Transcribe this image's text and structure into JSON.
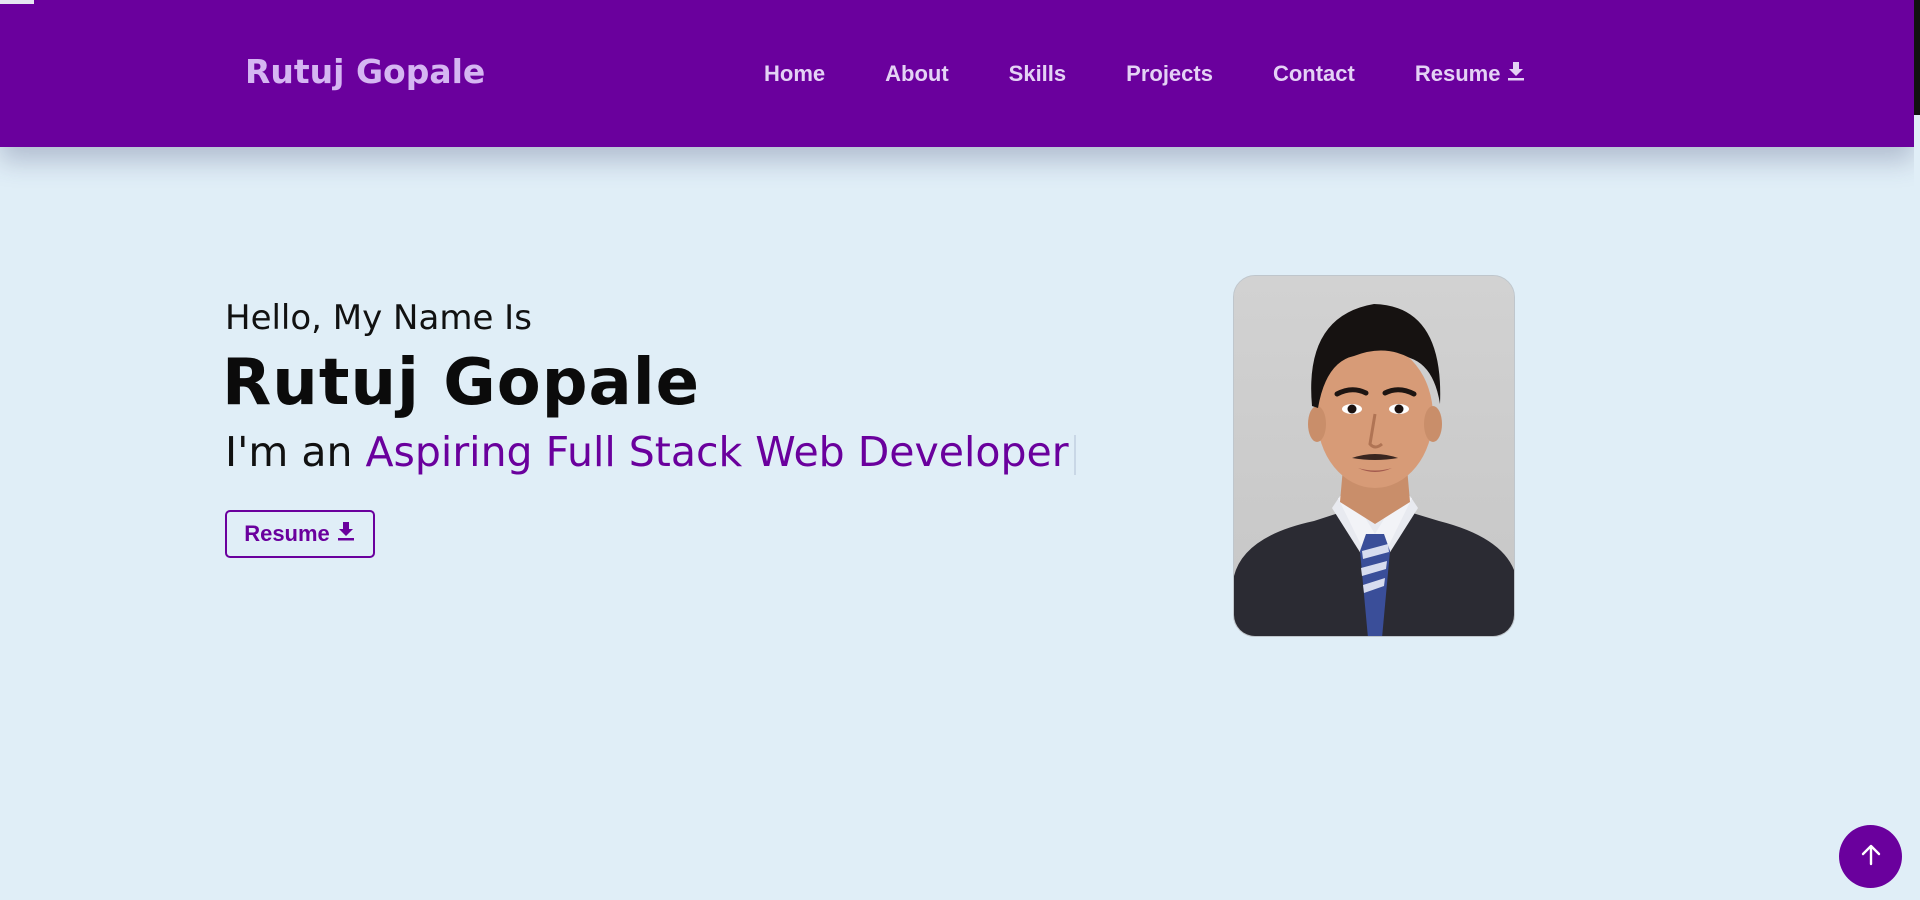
{
  "header": {
    "brand": "Rutuj Gopale",
    "nav_items": [
      {
        "label": "Home"
      },
      {
        "label": "About"
      },
      {
        "label": "Skills"
      },
      {
        "label": "Projects"
      },
      {
        "label": "Contact"
      },
      {
        "label": "Resume",
        "icon": "download-icon"
      }
    ]
  },
  "hero": {
    "greeting": "Hello, My Name Is",
    "name": "Rutuj Gopale",
    "role_prefix": "I'm an",
    "role_typed": "Aspiring Full Stack Web Developer",
    "resume_button": "Resume",
    "resume_icon": "download-icon",
    "photo_alt": "Rutuj Gopale"
  },
  "scroll_to_top": {
    "icon": "arrow-up-icon"
  },
  "colors": {
    "primary": "#6a009d",
    "background": "#e0eef7",
    "brand_text": "#d5b6f2",
    "nav_text": "#e4d2f5"
  }
}
